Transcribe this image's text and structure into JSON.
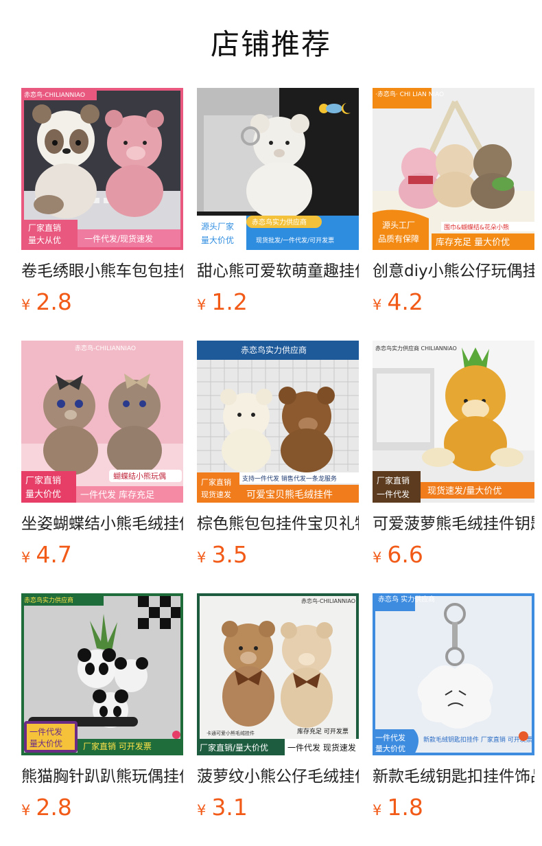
{
  "header": {
    "title": "店铺推荐"
  },
  "currency_symbol": "¥",
  "products": [
    {
      "title": "卷毛绣眼小熊车包包挂件",
      "price": "2.8",
      "image": {
        "brand": "赤恋鸟-CHILIANNIAO",
        "tag_left": [
          "厂家直销",
          "量大从优"
        ],
        "tag_right": "一件代发/现货速发"
      }
    },
    {
      "title": "甜心熊可爱软萌童趣挂件",
      "price": "1.2",
      "image": {
        "brand": "赤恋鸟实力供应商",
        "tag_left": [
          "源头厂家",
          "量大价优"
        ],
        "tag_right": "现货批发/一件代发/可开发票"
      }
    },
    {
      "title": "创意diy小熊公仔玩偶挂件",
      "price": "4.2",
      "image": {
        "brand": "·赤恋鸟· CHI LIAN NIAO",
        "tag_top": "围巾&蝴蝶结&花朵小熊",
        "tag_left": [
          "源头工厂",
          "品质有保障"
        ],
        "tag_right": "库存充足 量大价优"
      }
    },
    {
      "title": "坐姿蝴蝶结小熊毛绒挂件",
      "price": "4.7",
      "image": {
        "brand": "赤恋鸟-CHILIANNIAO",
        "tag_top": "蝴蝶结小熊玩偶",
        "tag_left": [
          "厂家直销",
          "量大价优"
        ],
        "tag_right": "一件代发 库存充足"
      }
    },
    {
      "title": "棕色熊包包挂件宝贝礼物",
      "price": "3.5",
      "image": {
        "brand": "赤恋鸟实力供应商",
        "tag_top": "支持一件代发 销售代发一条龙服务",
        "tag_left": [
          "厂家直销",
          "现货速发"
        ],
        "tag_right": "可爱宝贝熊毛绒挂件"
      }
    },
    {
      "title": "可爱菠萝熊毛绒挂件钥匙",
      "price": "6.6",
      "image": {
        "brand": "赤恋鸟实力供应商 CHILIANNIAO",
        "tag_left": [
          "厂家直销",
          "一件代发"
        ],
        "tag_right": "现货速发/量大价优"
      }
    },
    {
      "title": "熊猫胸针趴趴熊玩偶挂件",
      "price": "2.8",
      "image": {
        "brand": "赤恋鸟实力供应商",
        "tag_left": [
          "一件代发",
          "量大价优"
        ],
        "tag_right": "厂家直销 可开发票"
      }
    },
    {
      "title": "菠萝纹小熊公仔毛绒挂件",
      "price": "3.1",
      "image": {
        "brand": "赤恋鸟-CHILIANNIAO",
        "tag_top": "卡通可爱小熊毛绒挂件",
        "tag_top_right": "库存充足 可开发票",
        "tag_left": [
          "厂家直销/量大价优"
        ],
        "tag_right": "一件代发 现货速发"
      }
    },
    {
      "title": "新款毛绒钥匙扣挂件饰品",
      "price": "1.8",
      "image": {
        "brand": "赤恋鸟 实力供应商",
        "tag_left": [
          "一件代发",
          "量大价优"
        ],
        "tag_right": "新款毛绒钥匙扣挂件 厂家直销 可开发票"
      }
    }
  ]
}
